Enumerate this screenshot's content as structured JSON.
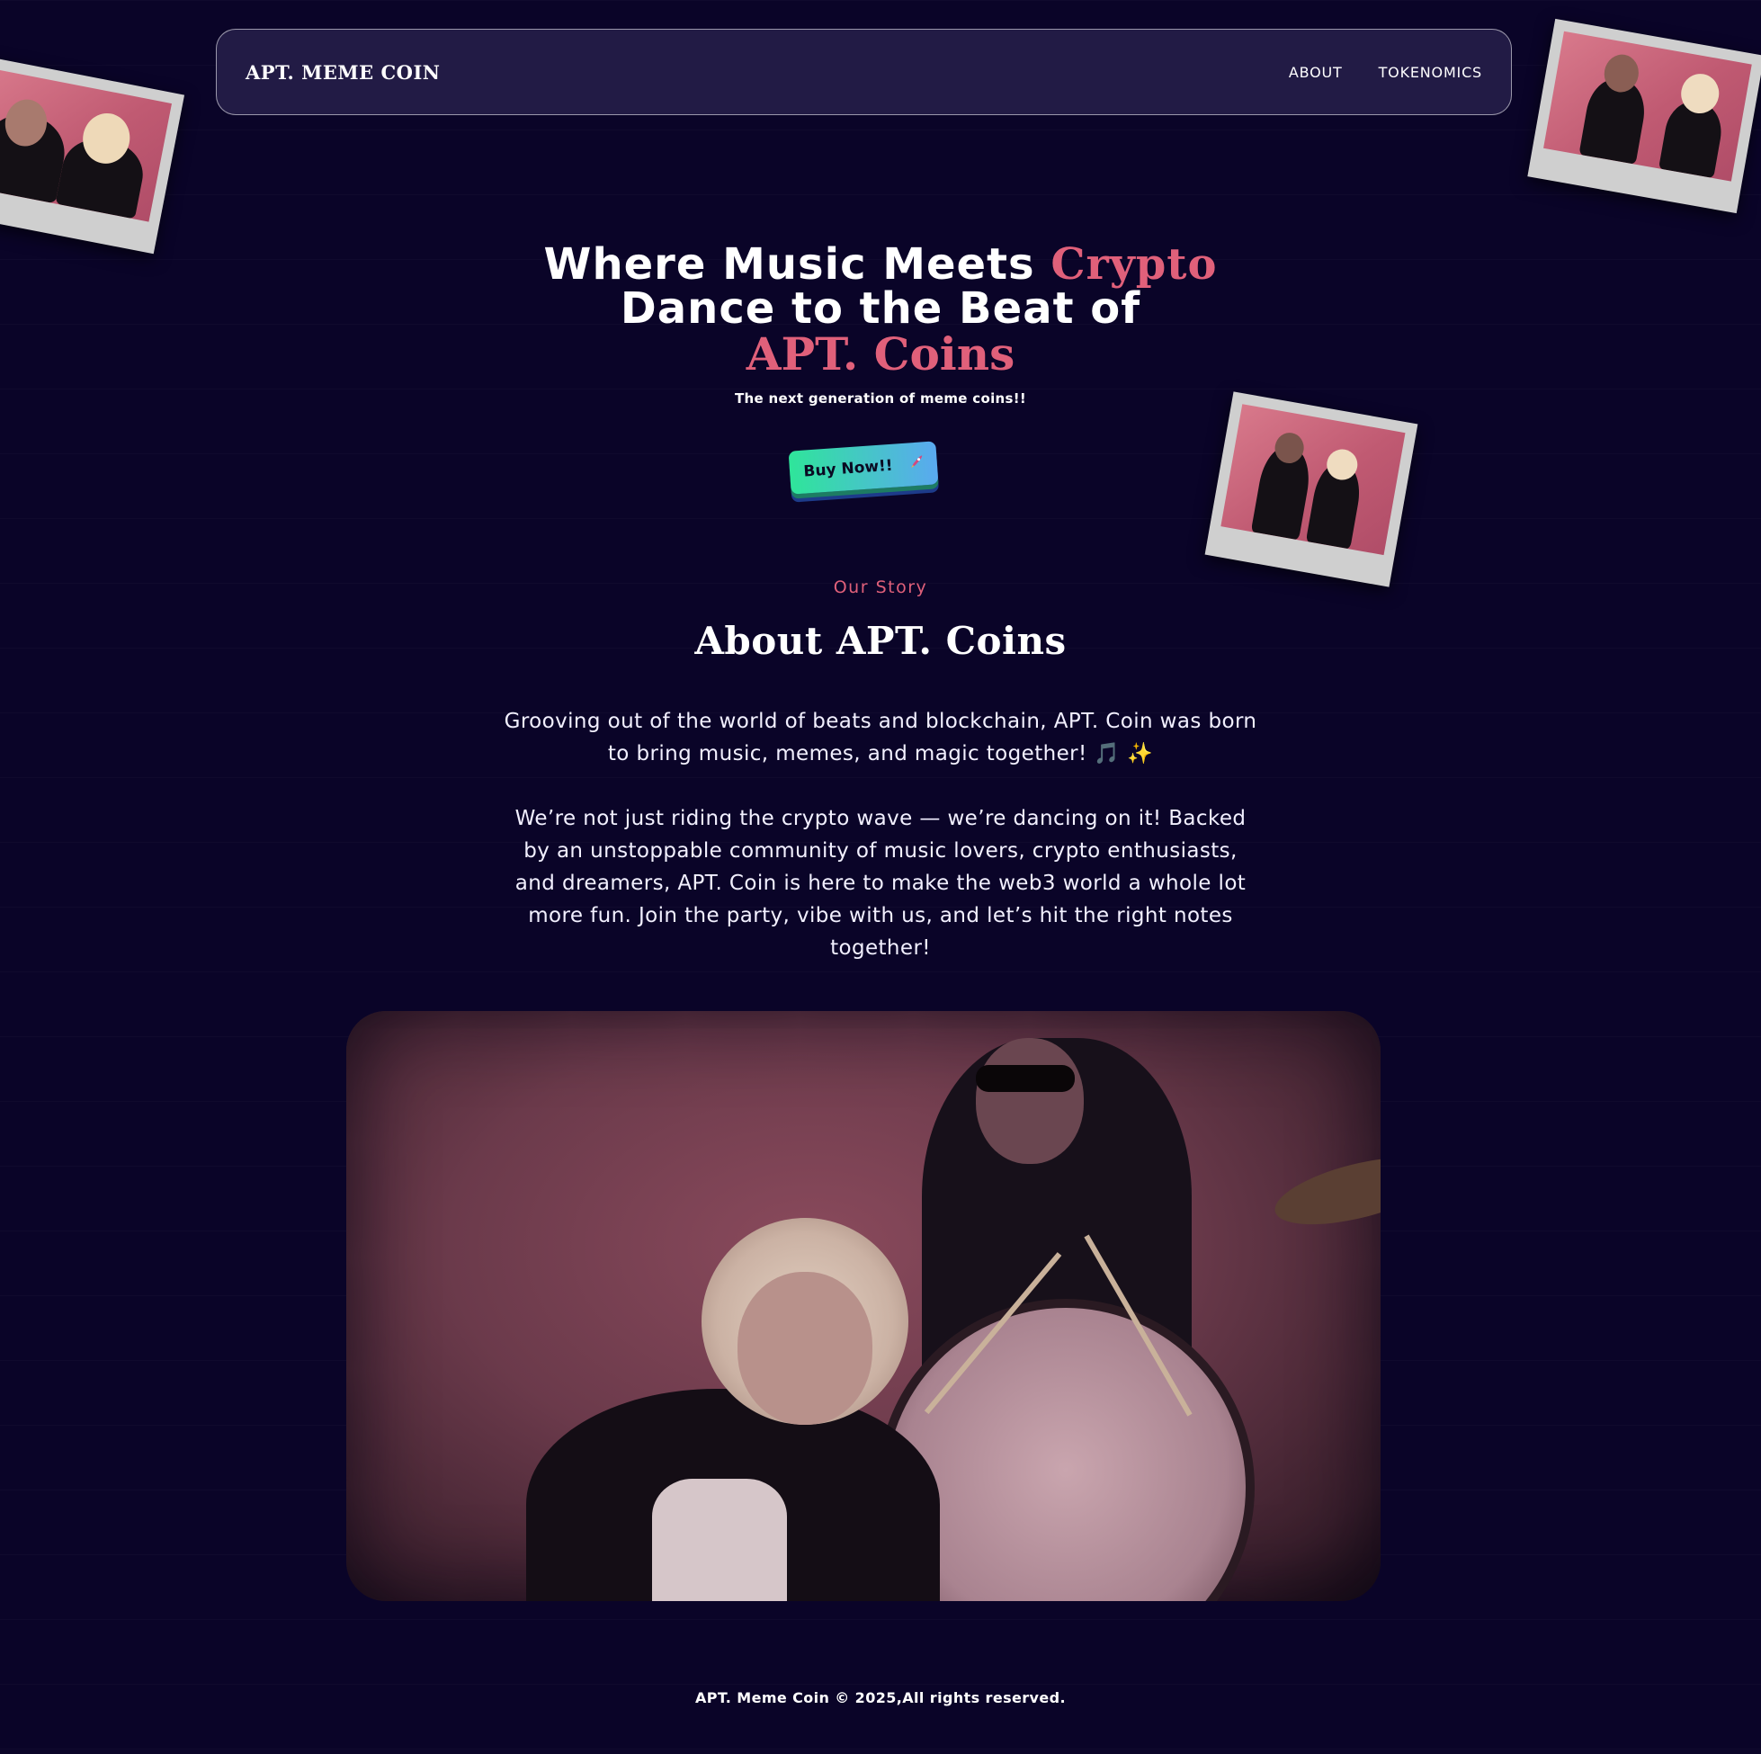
{
  "nav": {
    "brand": "APT. MEME COIN",
    "links": [
      "ABOUT",
      "TOKENOMICS"
    ]
  },
  "hero": {
    "line1_prefix": "Where Music Meets ",
    "line1_accent": "Crypto",
    "line2": "Dance to the Beat of",
    "line3_accent": "APT. Coins",
    "tagline": "The next generation of meme coins!!",
    "cta_label": "Buy Now!!",
    "cta_icon": "rocket-icon"
  },
  "about": {
    "eyebrow": "Our Story",
    "title": "About APT. Coins",
    "paragraph1": "Grooving out of the world of beats and blockchain, APT. Coin was born to bring music, memes, and magic together!",
    "paragraph1_emojis": "🎵 ✨",
    "paragraph2": "We’re not just riding the crypto wave — we’re dancing on it! Backed by an unstoppable community of music lovers, crypto enthusiasts, and dreamers, APT. Coin is here to make the web3 world a whole lot more fun. Join the party, vibe with us, and let’s hit the right notes together!"
  },
  "footer": {
    "text": "APT. Meme Coin © 2025,All rights reserved."
  },
  "colors": {
    "background": "#0a0428",
    "accent_pink": "#e0607a",
    "navbar_bg": "#221b45",
    "cta_gradient_start": "#2fe59a",
    "cta_gradient_end": "#5aa9f0"
  }
}
